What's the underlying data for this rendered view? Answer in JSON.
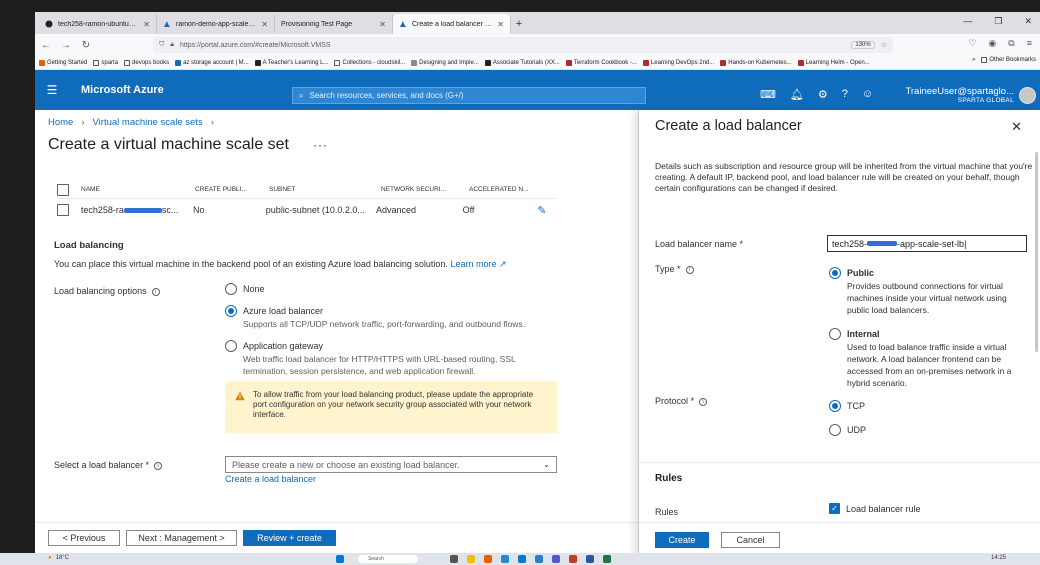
{
  "browser": {
    "tabs": [
      {
        "label": "tech258-ramon-ubuntu2204-a",
        "active": false
      },
      {
        "label": "ramon-demo-app-scale-set - N",
        "active": false
      },
      {
        "label": "Provisioning Test Page",
        "active": false
      },
      {
        "label": "Create a load balancer - Micro",
        "active": true
      }
    ],
    "url": "https://portal.azure.com/#create/Microsoft.VMSS",
    "zoom": "130%",
    "bookmarks": [
      "Getting Started",
      "sparta",
      "devops books",
      "az storage account | M...",
      "A Teacher's Learning L...",
      "Collections - cloudskil...",
      "Designing and Imple...",
      "Associate Tutorials (XX...",
      "Terraform Cookbook -...",
      "Learning DevOps 2nd...",
      "Hands-on Kubernetes...",
      "Learning Helm - Open..."
    ],
    "other_bookmarks": "Other Bookmarks"
  },
  "header": {
    "brand": "Microsoft Azure",
    "search_placeholder": "Search resources, services, and docs (G+/)",
    "user_name": "TraineeUser@spartaglo...",
    "user_org": "SPARTA GLOBAL"
  },
  "breadcrumb": {
    "home": "Home",
    "vmss": "Virtual machine scale sets"
  },
  "page_title": "Create a virtual machine scale set",
  "nic_grid": {
    "columns": [
      "NAME",
      "CREATE PUBLI...",
      "SUBNET",
      "NETWORK SECURI...",
      "ACCELERATED N..."
    ],
    "row": {
      "name_prefix": "tech258-ra",
      "name_suffix": "sc...",
      "create_public": "No",
      "subnet": "public-subnet (10.0.2.0...",
      "nsg": "Advanced",
      "accelerated": "Off"
    }
  },
  "load_balancing": {
    "section_title": "Load balancing",
    "description": "You can place this virtual machine in the backend pool of an existing Azure load balancing solution.",
    "learn_more": "Learn more",
    "options_label": "Load balancing options",
    "options": [
      {
        "label": "None",
        "desc": "",
        "selected": false
      },
      {
        "label": "Azure load balancer",
        "desc": "Supports all TCP/UDP network traffic, port-forwarding, and outbound flows.",
        "selected": true
      },
      {
        "label": "Application gateway",
        "desc": "Web traffic load balancer for HTTP/HTTPS with URL-based routing, SSL termination, session persistence, and web application firewall.",
        "selected": false
      }
    ],
    "warning": "To allow traffic from your load balancing product, please update the appropriate port configuration on your network security group associated with your network interface.",
    "select_label": "Select a load balancer *",
    "select_placeholder": "Please create a new or choose an existing load balancer.",
    "create_link": "Create a load balancer"
  },
  "footer": {
    "previous": "< Previous",
    "next": "Next : Management >",
    "review": "Review + create"
  },
  "blade": {
    "title": "Create a load balancer",
    "description": "Details such as subscription and resource group will be inherited from the virtual machine that you're creating. A default IP, backend pool, and load balancer rule will be created on your behalf, though certain configurations can be changed if desired.",
    "name_label": "Load balancer name *",
    "name_prefix": "tech258-",
    "name_suffix": "-app-scale-set-lb",
    "type_label": "Type *",
    "types": [
      {
        "label": "Public",
        "desc": "Provides outbound connections for virtual machines inside your virtual network using public load balancers.",
        "selected": true
      },
      {
        "label": "Internal",
        "desc": "Used to load balance traffic inside a virtual network. A load balancer frontend can be accessed from an on-premises network in a hybrid scenario.",
        "selected": false
      }
    ],
    "protocol_label": "Protocol *",
    "protocols": [
      {
        "label": "TCP",
        "selected": true
      },
      {
        "label": "UDP",
        "selected": false
      }
    ],
    "rules_title": "Rules",
    "rules_label": "Rules",
    "rule_checkbox": "Load balancer rule",
    "create": "Create",
    "cancel": "Cancel"
  },
  "taskbar": {
    "temp": "18°C",
    "search": "Search",
    "time": "14:25"
  },
  "colors": {
    "azure_blue": "#0f6cbd",
    "warning_bg": "#fff4ce",
    "warning_icon": "#d67f00"
  }
}
